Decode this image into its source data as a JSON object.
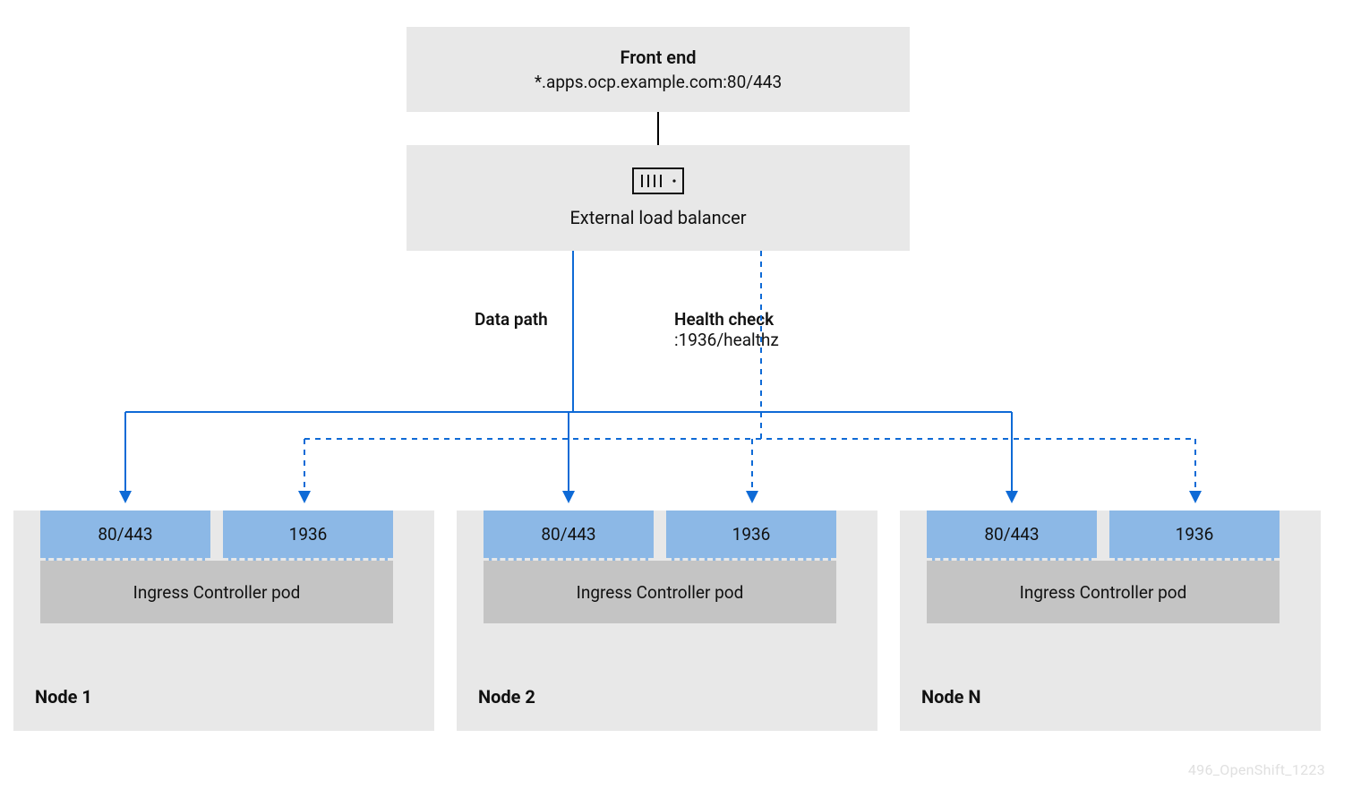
{
  "frontend": {
    "title": "Front end",
    "subtitle": "*.apps.ocp.example.com:80/443"
  },
  "load_balancer": {
    "label": "External load balancer"
  },
  "paths": {
    "data": "Data path",
    "health_title": "Health check",
    "health_sub": ":1936/healthz"
  },
  "node": {
    "port_data": "80/443",
    "port_health": "1936",
    "pod": "Ingress Controller pod",
    "n1": "Node 1",
    "n2": "Node 2",
    "nN": "Node N"
  },
  "watermark": "496_OpenShift_1223",
  "colors": {
    "box_bg": "#e8e8e8",
    "port_bg": "#8cb8e6",
    "pod_bg": "#c4c4c4",
    "line_blue": "#0e6ad6",
    "line_black": "#000000"
  }
}
